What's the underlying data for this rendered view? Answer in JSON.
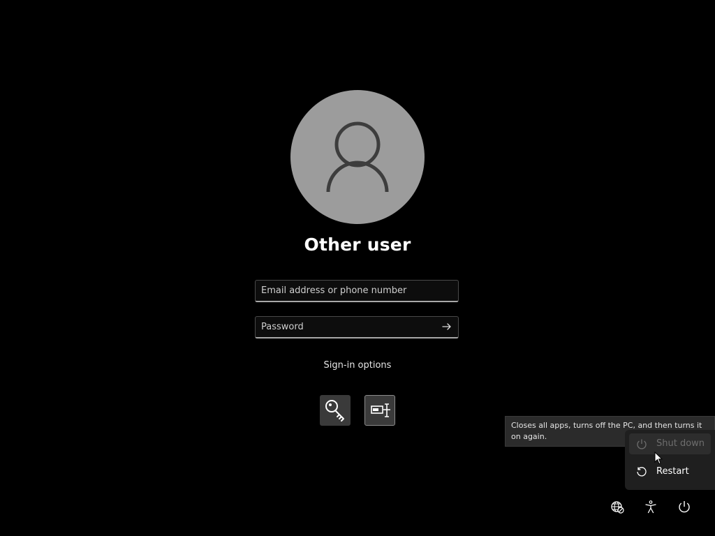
{
  "user": {
    "name": "Other user"
  },
  "login": {
    "email_placeholder": "Email address or phone number",
    "password_placeholder": "Password",
    "signin_options_label": "Sign-in options"
  },
  "signin_methods": [
    {
      "icon": "key-icon"
    },
    {
      "icon": "security-key-icon"
    }
  ],
  "tooltip": {
    "text": "Closes all apps, turns off the PC, and then turns it on again."
  },
  "power_menu": {
    "items": [
      {
        "label": "Shut down",
        "icon": "power-icon"
      },
      {
        "label": "Restart",
        "icon": "restart-icon"
      }
    ]
  },
  "bottom_bar": {
    "icons": [
      "network-icon",
      "accessibility-icon",
      "power-icon"
    ]
  },
  "colors": {
    "background": "#000000",
    "avatar_bg": "#9c9c9c",
    "avatar_glyph": "#3d3d3d",
    "menu_bg": "#1f1f1f",
    "tooltip_bg": "#2b2b2b"
  }
}
